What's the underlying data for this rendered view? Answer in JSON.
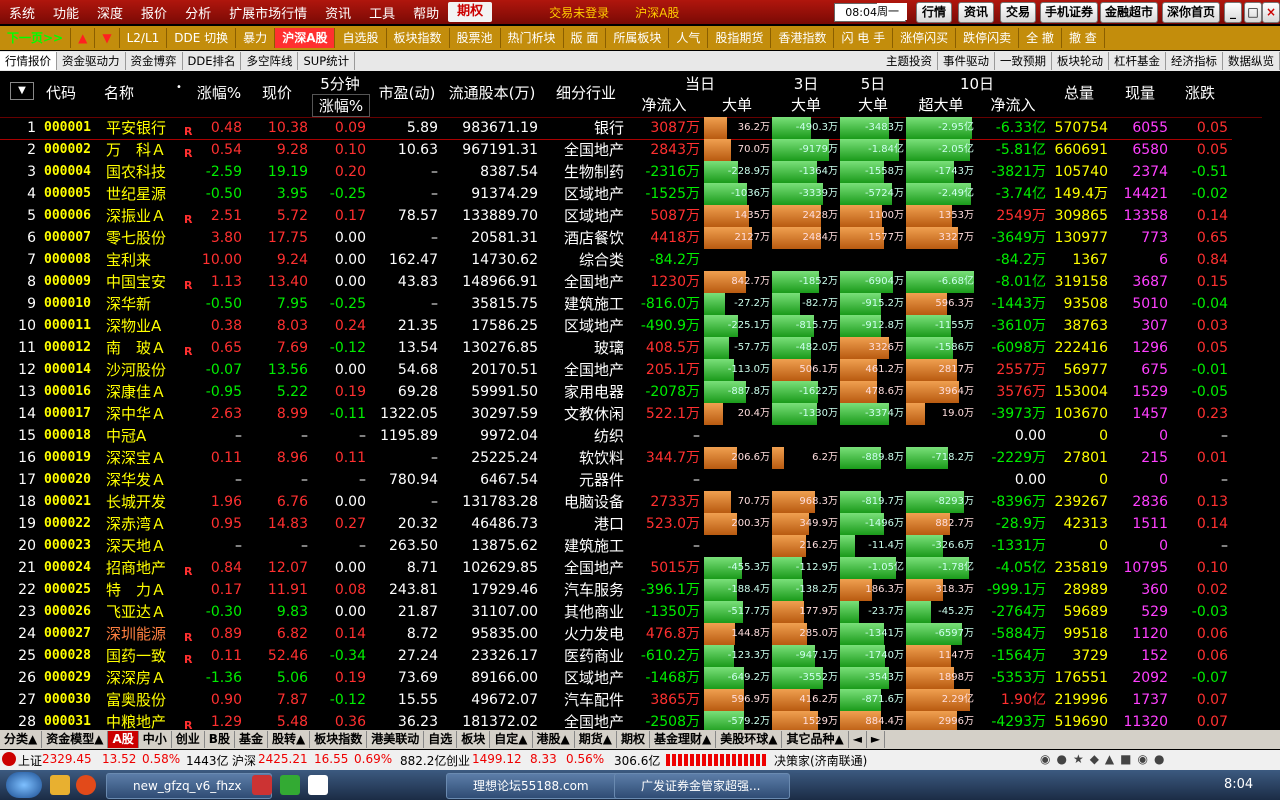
{
  "menu": [
    "系统",
    "功能",
    "深度",
    "报价",
    "分析",
    "扩展市场行情",
    "资讯",
    "工具",
    "帮助"
  ],
  "menu_active": "期权",
  "menu_center": [
    "交易未登录",
    "沪深A股"
  ],
  "clock": "08:04:16",
  "weekday": "周一",
  "top_buttons": [
    "行情",
    "资讯",
    "交易",
    "手机证券",
    "金融超市",
    "深你首页"
  ],
  "toolbar": [
    {
      "label": "下一页>>",
      "style": "green"
    },
    {
      "label": "▲",
      "style": "arrow"
    },
    {
      "label": "▼",
      "style": "arrow"
    },
    {
      "label": "L2/L1",
      "style": ""
    },
    {
      "label": "DDE 切换",
      "style": ""
    },
    {
      "label": "暴力",
      "style": ""
    },
    {
      "label": "沪深A股",
      "style": "active"
    },
    {
      "label": "自选股",
      "style": ""
    },
    {
      "label": "板块指数",
      "style": ""
    },
    {
      "label": "股票池",
      "style": ""
    },
    {
      "label": "热门析块",
      "style": ""
    },
    {
      "label": "版 面",
      "style": ""
    },
    {
      "label": "所属板块",
      "style": ""
    },
    {
      "label": "人气",
      "style": ""
    },
    {
      "label": "股指期货",
      "style": ""
    },
    {
      "label": "香港指数",
      "style": ""
    },
    {
      "label": "闪 电 手",
      "style": ""
    },
    {
      "label": "涨停闪买",
      "style": ""
    },
    {
      "label": "跌停闪卖",
      "style": ""
    },
    {
      "label": "全 撤",
      "style": ""
    },
    {
      "label": "撤 查",
      "style": ""
    }
  ],
  "tabs_left": [
    "行情报价",
    "资金驱动力",
    "资金博弈",
    "DDE排名",
    "多空阵线",
    "SUP统计"
  ],
  "tabs_right": [
    "主题投资",
    "事件驱动",
    "一致预期",
    "板块轮动",
    "杠杆基金",
    "经济指标",
    "数据纵览"
  ],
  "headers": {
    "code": "代码",
    "name": "名称",
    "change": "涨幅%",
    "price": "现价",
    "five_min_top": "5分钟",
    "five_min_bottom": "涨幅%",
    "pe": "市盈(动)",
    "float_cap": "流通股本(万)",
    "industry": "细分行业",
    "today": "当日",
    "net_in": "净流入",
    "big": "大单",
    "day3": "3日",
    "big3": "大单",
    "day5": "5日",
    "big5": "大单",
    "day10": "10日",
    "super_big": "超大单",
    "net_in10": "净流入",
    "total_vol": "总量",
    "cur_vol": "现量",
    "zhang": "涨跌"
  },
  "rows": [
    {
      "idx": "1",
      "code": "000001",
      "name": "平安银行",
      "r": "R",
      "chg": "0.48",
      "price": "10.38",
      "m5": "0.09",
      "pe": "5.89",
      "cap": "983671.19",
      "ind": "银行",
      "net": "3087万",
      "b1": "36.2万",
      "b3": "-490.3万",
      "b5": "-3483万",
      "sb": "-2.95亿",
      "net10": "-6.33亿",
      "tot": "570754",
      "cur": "6055",
      "z": "0.05"
    },
    {
      "idx": "2",
      "code": "000002",
      "name": "万　科Ａ",
      "r": "R",
      "chg": "0.54",
      "price": "9.28",
      "m5": "0.10",
      "pe": "10.63",
      "cap": "967191.31",
      "ind": "全国地产",
      "net": "2843万",
      "b1": "70.0万",
      "b3": "-9179万",
      "b5": "-1.84亿",
      "sb": "-2.05亿",
      "net10": "-5.81亿",
      "tot": "660691",
      "cur": "6580",
      "z": "0.05"
    },
    {
      "idx": "3",
      "code": "000004",
      "name": "国农科技",
      "r": "",
      "chg": "-2.59",
      "price": "19.19",
      "m5": "0.20",
      "pe": "–",
      "cap": "8387.54",
      "ind": "生物制药",
      "net": "-2316万",
      "b1": "-228.9万",
      "b3": "-1364万",
      "b5": "-1558万",
      "sb": "-1743万",
      "net10": "-3821万",
      "tot": "105740",
      "cur": "2374",
      "z": "-0.51"
    },
    {
      "idx": "4",
      "code": "000005",
      "name": "世纪星源",
      "r": "",
      "chg": "-0.50",
      "price": "3.95",
      "m5": "-0.25",
      "pe": "–",
      "cap": "91374.29",
      "ind": "区域地产",
      "net": "-1525万",
      "b1": "-1036万",
      "b3": "-3339万",
      "b5": "-5724万",
      "sb": "-2.49亿",
      "net10": "-3.74亿",
      "tot": "149.4万",
      "cur": "14421",
      "z": "-0.02"
    },
    {
      "idx": "5",
      "code": "000006",
      "name": "深振业Ａ",
      "r": "R",
      "chg": "2.51",
      "price": "5.72",
      "m5": "0.17",
      "pe": "78.57",
      "cap": "133889.70",
      "ind": "区域地产",
      "net": "5087万",
      "b1": "1435万",
      "b3": "2428万",
      "b5": "1100万",
      "sb": "1353万",
      "net10": "2549万",
      "tot": "309865",
      "cur": "13358",
      "z": "0.14"
    },
    {
      "idx": "6",
      "code": "000007",
      "name": "零七股份",
      "r": "",
      "chg": "3.80",
      "price": "17.75",
      "m5": "0.00",
      "pe": "–",
      "cap": "20581.31",
      "ind": "酒店餐饮",
      "net": "4418万",
      "b1": "2127万",
      "b3": "2484万",
      "b5": "1577万",
      "sb": "3327万",
      "net10": "-3649万",
      "tot": "130977",
      "cur": "773",
      "z": "0.65"
    },
    {
      "idx": "7",
      "code": "000008",
      "name": "宝利来",
      "r": "",
      "chg": "10.00",
      "price": "9.24",
      "m5": "0.00",
      "pe": "162.47",
      "cap": "14730.62",
      "ind": "综合类",
      "net": "-84.2万",
      "b1": "",
      "b3": "",
      "b5": "",
      "sb": "",
      "net10": "-84.2万",
      "tot": "1367",
      "cur": "6",
      "z": "0.84"
    },
    {
      "idx": "8",
      "code": "000009",
      "name": "中国宝安",
      "r": "R",
      "chg": "1.13",
      "price": "13.40",
      "m5": "0.00",
      "pe": "43.83",
      "cap": "148966.91",
      "ind": "全国地产",
      "net": "1230万",
      "b1": "842.7万",
      "b3": "-1852万",
      "b5": "-6904万",
      "sb": "-6.68亿",
      "net10": "-8.01亿",
      "tot": "319158",
      "cur": "3687",
      "z": "0.15"
    },
    {
      "idx": "9",
      "code": "000010",
      "name": "深华新",
      "r": "",
      "chg": "-0.50",
      "price": "7.95",
      "m5": "-0.25",
      "pe": "–",
      "cap": "35815.75",
      "ind": "建筑施工",
      "net": "-816.0万",
      "b1": "-27.2万",
      "b3": "-82.7万",
      "b5": "-915.2万",
      "sb": "596.3万",
      "net10": "-1443万",
      "tot": "93508",
      "cur": "5010",
      "z": "-0.04"
    },
    {
      "idx": "10",
      "code": "000011",
      "name": "深物业A",
      "r": "",
      "chg": "0.38",
      "price": "8.03",
      "m5": "0.24",
      "pe": "21.35",
      "cap": "17586.25",
      "ind": "区域地产",
      "net": "-490.9万",
      "b1": "-225.1万",
      "b3": "-815.7万",
      "b5": "-912.8万",
      "sb": "-1155万",
      "net10": "-3610万",
      "tot": "38763",
      "cur": "307",
      "z": "0.03"
    },
    {
      "idx": "11",
      "code": "000012",
      "name": "南　玻Ａ",
      "r": "R",
      "chg": "0.65",
      "price": "7.69",
      "m5": "-0.12",
      "pe": "13.54",
      "cap": "130276.85",
      "ind": "玻璃",
      "net": "408.5万",
      "b1": "-57.7万",
      "b3": "-482.0万",
      "b5": "3326万",
      "sb": "-1586万",
      "net10": "-6098万",
      "tot": "222416",
      "cur": "1296",
      "z": "0.05"
    },
    {
      "idx": "12",
      "code": "000014",
      "name": "沙河股份",
      "r": "",
      "chg": "-0.07",
      "price": "13.56",
      "m5": "0.00",
      "pe": "54.68",
      "cap": "20170.51",
      "ind": "全国地产",
      "net": "205.1万",
      "b1": "-113.0万",
      "b3": "506.1万",
      "b5": "461.2万",
      "sb": "2817万",
      "net10": "2557万",
      "tot": "56977",
      "cur": "675",
      "z": "-0.01"
    },
    {
      "idx": "13",
      "code": "000016",
      "name": "深康佳Ａ",
      "r": "",
      "chg": "-0.95",
      "price": "5.22",
      "m5": "0.19",
      "pe": "69.28",
      "cap": "59991.50",
      "ind": "家用电器",
      "net": "-2078万",
      "b1": "-887.8万",
      "b3": "-1622万",
      "b5": "478.6万",
      "sb": "3964万",
      "net10": "3576万",
      "tot": "153004",
      "cur": "1529",
      "z": "-0.05"
    },
    {
      "idx": "14",
      "code": "000017",
      "name": "深中华Ａ",
      "r": "",
      "chg": "2.63",
      "price": "8.99",
      "m5": "-0.11",
      "pe": "1322.05",
      "cap": "30297.59",
      "ind": "文教休闲",
      "net": "522.1万",
      "b1": "20.4万",
      "b3": "-1330万",
      "b5": "-3374万",
      "sb": "19.0万",
      "net10": "-3973万",
      "tot": "103670",
      "cur": "1457",
      "z": "0.23"
    },
    {
      "idx": "15",
      "code": "000018",
      "name": "中冠A",
      "r": "",
      "chg": "–",
      "price": "–",
      "m5": "–",
      "pe": "1195.89",
      "cap": "9972.04",
      "ind": "纺织",
      "net": "–",
      "b1": "",
      "b3": "",
      "b5": "",
      "sb": "",
      "net10": "0.00",
      "tot": "0",
      "cur": "0",
      "z": "–"
    },
    {
      "idx": "16",
      "code": "000019",
      "name": "深深宝Ａ",
      "r": "",
      "chg": "0.11",
      "price": "8.96",
      "m5": "0.11",
      "pe": "–",
      "cap": "25225.24",
      "ind": "软饮料",
      "net": "344.7万",
      "b1": "206.6万",
      "b3": "6.2万",
      "b5": "-889.8万",
      "sb": "-718.2万",
      "net10": "-2229万",
      "tot": "27801",
      "cur": "215",
      "z": "0.01"
    },
    {
      "idx": "17",
      "code": "000020",
      "name": "深华发Ａ",
      "r": "",
      "chg": "–",
      "price": "–",
      "m5": "–",
      "pe": "780.94",
      "cap": "6467.54",
      "ind": "元器件",
      "net": "–",
      "b1": "",
      "b3": "",
      "b5": "",
      "sb": "",
      "net10": "0.00",
      "tot": "0",
      "cur": "0",
      "z": "–"
    },
    {
      "idx": "18",
      "code": "000021",
      "name": "长城开发",
      "r": "",
      "chg": "1.96",
      "price": "6.76",
      "m5": "0.00",
      "pe": "–",
      "cap": "131783.28",
      "ind": "电脑设备",
      "net": "2733万",
      "b1": "70.7万",
      "b3": "968.3万",
      "b5": "-819.7万",
      "sb": "-8293万",
      "net10": "-8396万",
      "tot": "239267",
      "cur": "2836",
      "z": "0.13"
    },
    {
      "idx": "19",
      "code": "000022",
      "name": "深赤湾Ａ",
      "r": "",
      "chg": "0.95",
      "price": "14.83",
      "m5": "0.27",
      "pe": "20.32",
      "cap": "46486.73",
      "ind": "港口",
      "net": "523.0万",
      "b1": "200.3万",
      "b3": "349.9万",
      "b5": "-1496万",
      "sb": "882.7万",
      "net10": "-28.9万",
      "tot": "42313",
      "cur": "1511",
      "z": "0.14"
    },
    {
      "idx": "20",
      "code": "000023",
      "name": "深天地Ａ",
      "r": "",
      "chg": "–",
      "price": "–",
      "m5": "–",
      "pe": "263.50",
      "cap": "13875.62",
      "ind": "建筑施工",
      "net": "–",
      "b1": "",
      "b3": "216.2万",
      "b5": "-11.4万",
      "sb": "-326.6万",
      "net10": "-1331万",
      "tot": "0",
      "cur": "0",
      "z": "–"
    },
    {
      "idx": "21",
      "code": "000024",
      "name": "招商地产",
      "r": "R",
      "chg": "0.84",
      "price": "12.07",
      "m5": "0.00",
      "pe": "8.71",
      "cap": "102629.85",
      "ind": "全国地产",
      "net": "5015万",
      "b1": "-455.3万",
      "b3": "-112.9万",
      "b5": "-1.05亿",
      "sb": "-1.78亿",
      "net10": "-4.05亿",
      "tot": "235819",
      "cur": "10795",
      "z": "0.10"
    },
    {
      "idx": "22",
      "code": "000025",
      "name": "特　力Ａ",
      "r": "",
      "chg": "0.17",
      "price": "11.91",
      "m5": "0.08",
      "pe": "243.81",
      "cap": "17929.46",
      "ind": "汽车服务",
      "net": "-396.1万",
      "b1": "-188.4万",
      "b3": "-138.2万",
      "b5": "186.3万",
      "sb": "318.3万",
      "net10": "-999.1万",
      "tot": "28989",
      "cur": "360",
      "z": "0.02"
    },
    {
      "idx": "23",
      "code": "000026",
      "name": "飞亚达Ａ",
      "r": "",
      "chg": "-0.30",
      "price": "9.83",
      "m5": "0.00",
      "pe": "21.87",
      "cap": "31107.00",
      "ind": "其他商业",
      "net": "-1350万",
      "b1": "-517.7万",
      "b3": "177.9万",
      "b5": "-23.7万",
      "sb": "-45.2万",
      "net10": "-2764万",
      "tot": "59689",
      "cur": "529",
      "z": "-0.03"
    },
    {
      "idx": "24",
      "code": "000027",
      "name": "深圳能源",
      "r": "R",
      "chg": "0.89",
      "price": "6.82",
      "m5": "0.14",
      "pe": "8.72",
      "cap": "95835.00",
      "ind": "火力发电",
      "net": "476.8万",
      "b1": "144.8万",
      "b3": "285.0万",
      "b5": "-1341万",
      "sb": "-6597万",
      "net10": "-5884万",
      "tot": "99518",
      "cur": "1120",
      "z": "0.06"
    },
    {
      "idx": "25",
      "code": "000028",
      "name": "国药一致",
      "r": "R",
      "chg": "0.11",
      "price": "52.46",
      "m5": "-0.34",
      "pe": "27.24",
      "cap": "23326.17",
      "ind": "医药商业",
      "net": "-610.2万",
      "b1": "-123.3万",
      "b3": "-947.1万",
      "b5": "-1740万",
      "sb": "1147万",
      "net10": "-1564万",
      "tot": "3729",
      "cur": "152",
      "z": "0.06"
    },
    {
      "idx": "26",
      "code": "000029",
      "name": "深深房Ａ",
      "r": "",
      "chg": "-1.36",
      "price": "5.06",
      "m5": "0.19",
      "pe": "73.69",
      "cap": "89166.00",
      "ind": "区域地产",
      "net": "-1468万",
      "b1": "-649.2万",
      "b3": "-3552万",
      "b5": "-3543万",
      "sb": "1898万",
      "net10": "-5353万",
      "tot": "176551",
      "cur": "2092",
      "z": "-0.07"
    },
    {
      "idx": "27",
      "code": "000030",
      "name": "富奥股份",
      "r": "",
      "chg": "0.90",
      "price": "7.87",
      "m5": "-0.12",
      "pe": "15.55",
      "cap": "49672.07",
      "ind": "汽车配件",
      "net": "3865万",
      "b1": "596.9万",
      "b3": "416.2万",
      "b5": "-871.6万",
      "sb": "2.29亿",
      "net10": "1.90亿",
      "tot": "219996",
      "cur": "1737",
      "z": "0.07"
    },
    {
      "idx": "28",
      "code": "000031",
      "name": "中粮地产",
      "r": "R",
      "chg": "1.29",
      "price": "5.48",
      "m5": "0.36",
      "pe": "36.23",
      "cap": "181372.02",
      "ind": "全国地产",
      "net": "-2508万",
      "b1": "-579.2万",
      "b3": "1529万",
      "b5": "884.4万",
      "sb": "2996万",
      "net10": "-4293万",
      "tot": "519690",
      "cur": "11320",
      "z": "0.07"
    }
  ],
  "bottom_tabs": [
    "分类▲",
    "资金模型▲",
    "A股",
    "中小",
    "创业",
    "B股",
    "基金",
    "股转▲",
    "板块指数",
    "港美联动",
    "自选",
    "板块",
    "自定▲",
    "港股▲",
    "期货▲",
    "期权",
    "基金理财▲",
    "美股环球▲",
    "其它品种▲"
  ],
  "bottom_active": "A股",
  "index_strip": {
    "sh_label": "上证",
    "sh_value": "2329.45",
    "sh_chg": "13.52",
    "sh_pct": "0.58%",
    "sh_amt": "1443亿",
    "hs_label": "沪深",
    "hs_value": "2425.21",
    "hs_chg": "16.55",
    "hs_pct": "0.69%",
    "hs_amt": "882.2亿",
    "cy_label": "创业",
    "cy_value": "1499.12",
    "cy_chg": "8.33",
    "cy_pct": "0.56%",
    "cy_amt": "306.6亿",
    "broker": "决策家(济南联通)"
  },
  "taskbar": {
    "tasks": [
      "new_gfzq_v6_fhzx",
      "理想论坛55188.com",
      "广发证券金管家超强..."
    ],
    "time": "8:04"
  }
}
